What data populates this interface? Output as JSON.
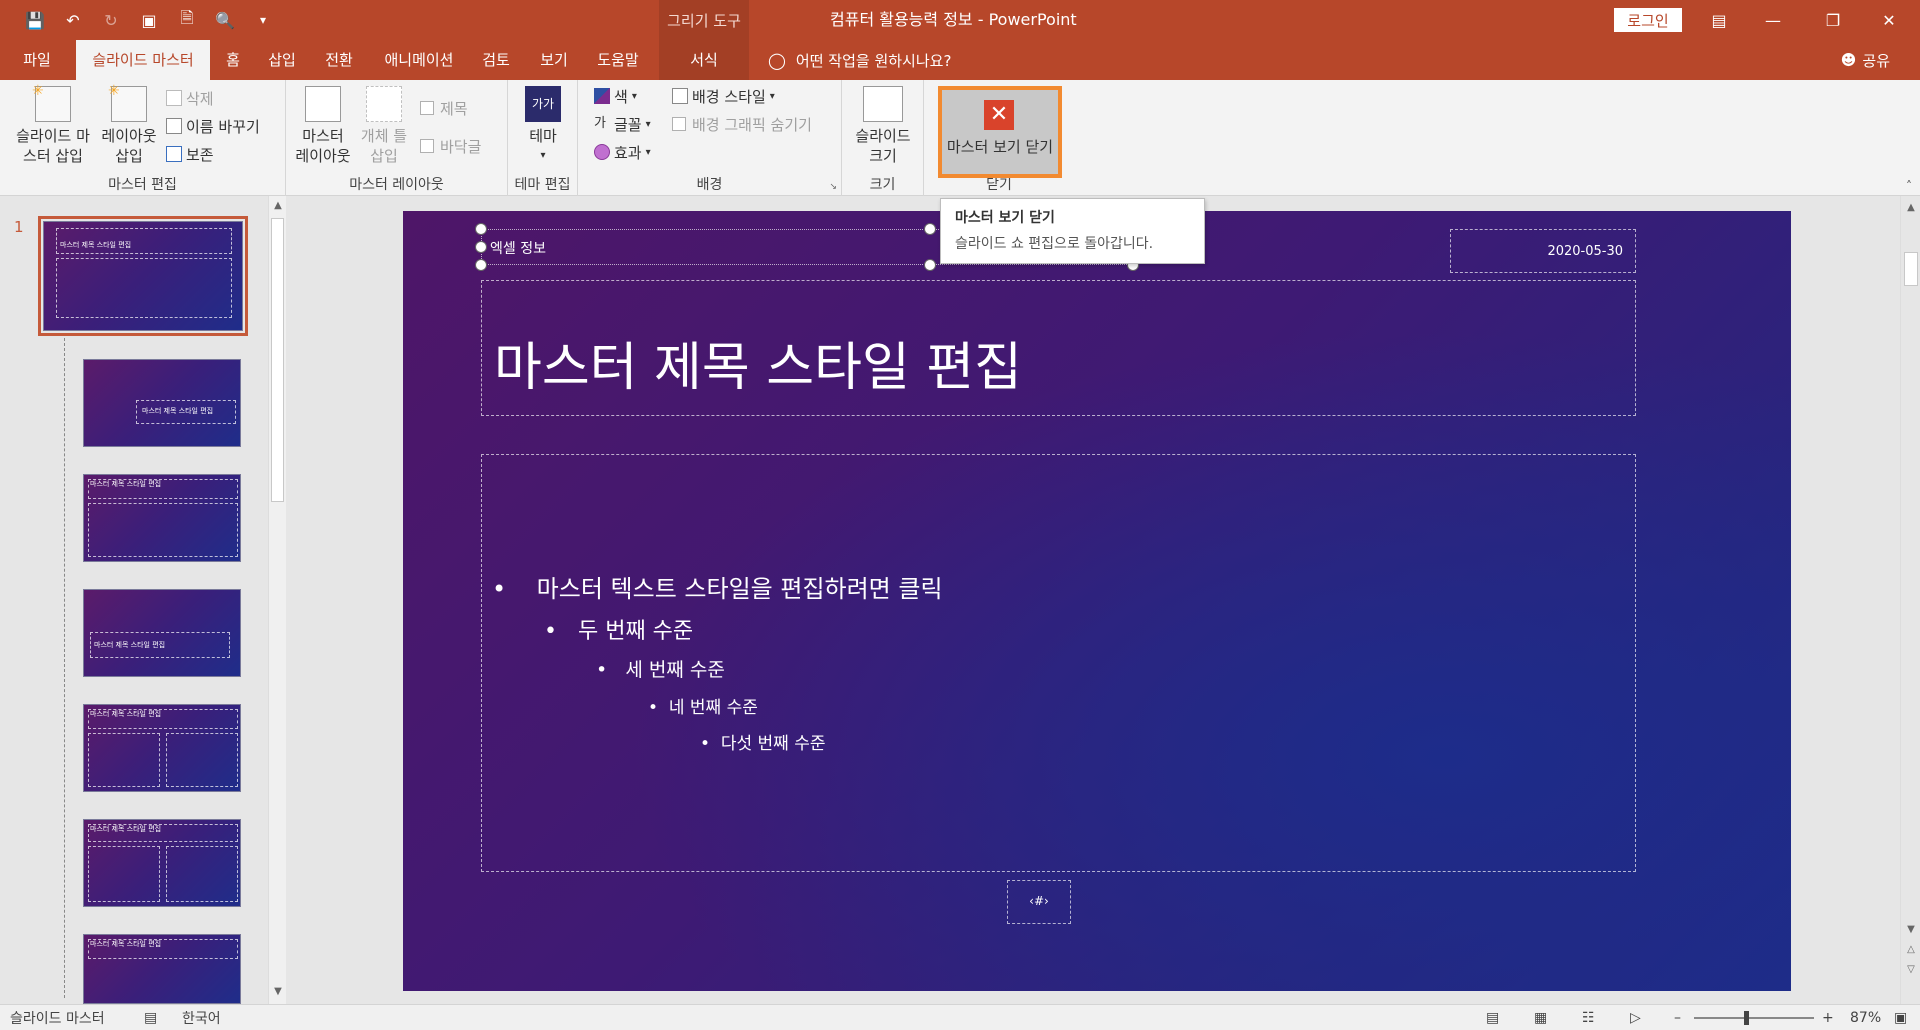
{
  "window": {
    "contextual_tab_header": "그리기 도구",
    "title": "컴퓨터 활용능력 정보  -  PowerPoint",
    "login": "로그인"
  },
  "tabs": [
    {
      "label": "파일"
    },
    {
      "label": "슬라이드 마스터"
    },
    {
      "label": "홈"
    },
    {
      "label": "삽입"
    },
    {
      "label": "전환"
    },
    {
      "label": "애니메이션"
    },
    {
      "label": "검토"
    },
    {
      "label": "보기"
    },
    {
      "label": "도움말"
    },
    {
      "label": "서식"
    }
  ],
  "tellme": "어떤 작업을 원하시나요?",
  "share": "공유",
  "ribbon": {
    "master_edit": {
      "insert_master_line1": "슬라이드 마",
      "insert_master_line2": "스터 삽입",
      "insert_layout_line1": "레이아웃",
      "insert_layout_line2": "삽입",
      "delete": "삭제",
      "rename": "이름 바꾸기",
      "preserve": "보존",
      "group_label": "마스터 편집"
    },
    "master_layout": {
      "master_layout_line1": "마스터",
      "master_layout_line2": "레이아웃",
      "insert_placeholder_line1": "개체 틀",
      "insert_placeholder_line2": "삽입",
      "title_check": "제목",
      "footer_check": "바닥글",
      "group_label": "마스터 레이아웃"
    },
    "edit_theme": {
      "theme": "테마",
      "theme_icon_text": "가가",
      "group_label": "테마 편집"
    },
    "background": {
      "colors": "색",
      "fonts": "글꼴",
      "effects": "효과",
      "bg_styles": "배경 스타일",
      "hide_bg": "배경 그래픽 숨기기",
      "group_label": "배경"
    },
    "size": {
      "slide_size_line1": "슬라이드",
      "slide_size_line2": "크기",
      "group_label": "크기"
    },
    "close": {
      "close_master": "마스터 보기 닫기",
      "group_label": "닫기"
    }
  },
  "tooltip": {
    "title": "마스터 보기 닫기",
    "desc": "슬라이드 쇼 편집으로 돌아갑니다."
  },
  "thumbnails": {
    "selected_number": "1",
    "items": [
      {
        "title": "마스터 제목 스타일 편집"
      },
      {
        "title": "마스터 제목 스타일 편집"
      },
      {
        "title": "마스터 제목 스타일 편집"
      },
      {
        "title": "마스터 제목 스타일 편집"
      },
      {
        "title": "마스터 제목 스타일 편집"
      },
      {
        "title": "마스터 제목 스타일 편집"
      },
      {
        "title": "마스터 제목 스타일 편집"
      }
    ]
  },
  "slide": {
    "header_text": "엑셀 정보",
    "date": "2020-05-30",
    "title": "마스터 제목 스타일 편집",
    "bullet1": "마스터 텍스트 스타일을 편집하려면 클릭",
    "bullet2": "두 번째 수준",
    "bullet3": "세 번째 수준",
    "bullet4": "네 번째 수준",
    "bullet5": "다섯 번째 수준",
    "slide_number": "‹#›"
  },
  "status": {
    "view": "슬라이드 마스터",
    "language": "한국어",
    "zoom": "87%"
  },
  "colors": {
    "accent": "#b7472a",
    "highlight": "#f28a30"
  }
}
